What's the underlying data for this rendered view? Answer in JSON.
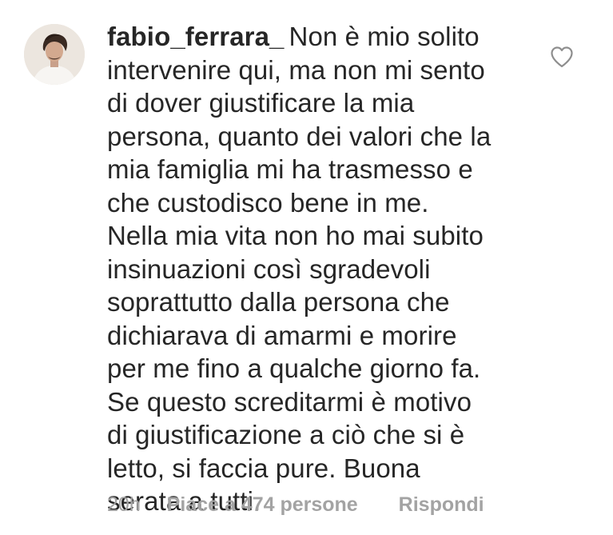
{
  "comment": {
    "username": "fabio_ferrara_",
    "avatar_icon": "user-profile-photo",
    "like_icon": "heart-outline-icon",
    "text_lines": [
      "Non è mio solito",
      "intervenire qui, ma non mi sento",
      "di dover giustificare la mia",
      "persona, quanto dei valori che la",
      "mia famiglia mi ha trasmesso e",
      "che custodisco bene in me.",
      "Nella mia vita non ho mai subito",
      "insinuazioni così sgradevoli",
      "soprattutto dalla persona che",
      "dichiarava di amarmi e morire",
      "per me fino a qualche giorno fa.",
      "Se questo screditarmi è motivo",
      "di giustificazione a ciò che si è",
      "letto, si faccia pure. Buona",
      "serata a tutti."
    ],
    "time": "20h",
    "likes_label": "Piace a 474 persone",
    "reply_label": "Rispondi"
  }
}
